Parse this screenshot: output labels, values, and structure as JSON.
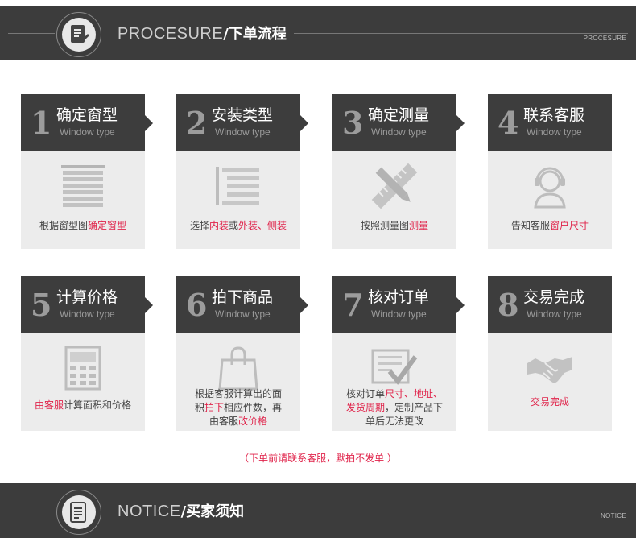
{
  "header": {
    "title_en": "PROCESURE",
    "title_cn": "/下单流程",
    "small_label": "PROCESURE",
    "icon": "document-icon"
  },
  "steps": [
    {
      "num": "1",
      "title": "确定窗型",
      "subtitle": "Window type",
      "icon": "blinds-icon",
      "desc": [
        {
          "t": "根据窗型图",
          "h": false
        },
        {
          "t": "确定窗型",
          "h": true
        }
      ]
    },
    {
      "num": "2",
      "title": "安装类型",
      "subtitle": "Window type",
      "icon": "list-icon",
      "desc": [
        {
          "t": "选择",
          "h": false
        },
        {
          "t": "内装",
          "h": true
        },
        {
          "t": "或",
          "h": false
        },
        {
          "t": "外装、侧装",
          "h": true
        }
      ]
    },
    {
      "num": "3",
      "title": "确定测量",
      "subtitle": "Window type",
      "icon": "ruler-pencil-icon",
      "desc": [
        {
          "t": "按照测量图",
          "h": false
        },
        {
          "t": "测量",
          "h": true
        }
      ]
    },
    {
      "num": "4",
      "title": "联系客服",
      "subtitle": "Window type",
      "icon": "headset-icon",
      "desc": [
        {
          "t": "告知客服",
          "h": false
        },
        {
          "t": "窗户尺寸",
          "h": true
        }
      ]
    },
    {
      "num": "5",
      "title": "计算价格",
      "subtitle": "Window type",
      "icon": "calculator-icon",
      "desc": [
        {
          "t": "由客服",
          "h": true
        },
        {
          "t": "计算面积和价格",
          "h": false
        }
      ]
    },
    {
      "num": "6",
      "title": "拍下商品",
      "subtitle": "Window type",
      "icon": "shopping-bag-icon",
      "desc": [
        {
          "t": "根据客服计算出的面",
          "h": false
        },
        {
          "br": true
        },
        {
          "t": "积",
          "h": false
        },
        {
          "t": "拍下",
          "h": true
        },
        {
          "t": "相应件数，再",
          "h": false
        },
        {
          "br": true
        },
        {
          "t": "由客服",
          "h": false
        },
        {
          "t": "改价格",
          "h": true
        }
      ]
    },
    {
      "num": "7",
      "title": "核对订单",
      "subtitle": "Window type",
      "icon": "checklist-icon",
      "desc": [
        {
          "t": "核对订单",
          "h": false
        },
        {
          "t": "尺寸、地址、",
          "h": true
        },
        {
          "br": true
        },
        {
          "t": "发货周期",
          "h": true
        },
        {
          "t": "，定制产品下",
          "h": false
        },
        {
          "br": true
        },
        {
          "t": "单后无法更改",
          "h": false
        }
      ]
    },
    {
      "num": "8",
      "title": "交易完成",
      "subtitle": "Window type",
      "icon": "handshake-icon",
      "desc": [
        {
          "t": "交易完成",
          "h": true
        }
      ]
    }
  ],
  "note": "（下单前请联系客服，默拍不发单 ）",
  "footer": {
    "title_en": "NOTICE",
    "title_cn": "/买家须知",
    "small_label": "NOTICE",
    "icon": "notice-document-icon"
  },
  "colors": {
    "accent": "#e0234a",
    "dark": "#3d3d3d",
    "card": "#ececec"
  }
}
